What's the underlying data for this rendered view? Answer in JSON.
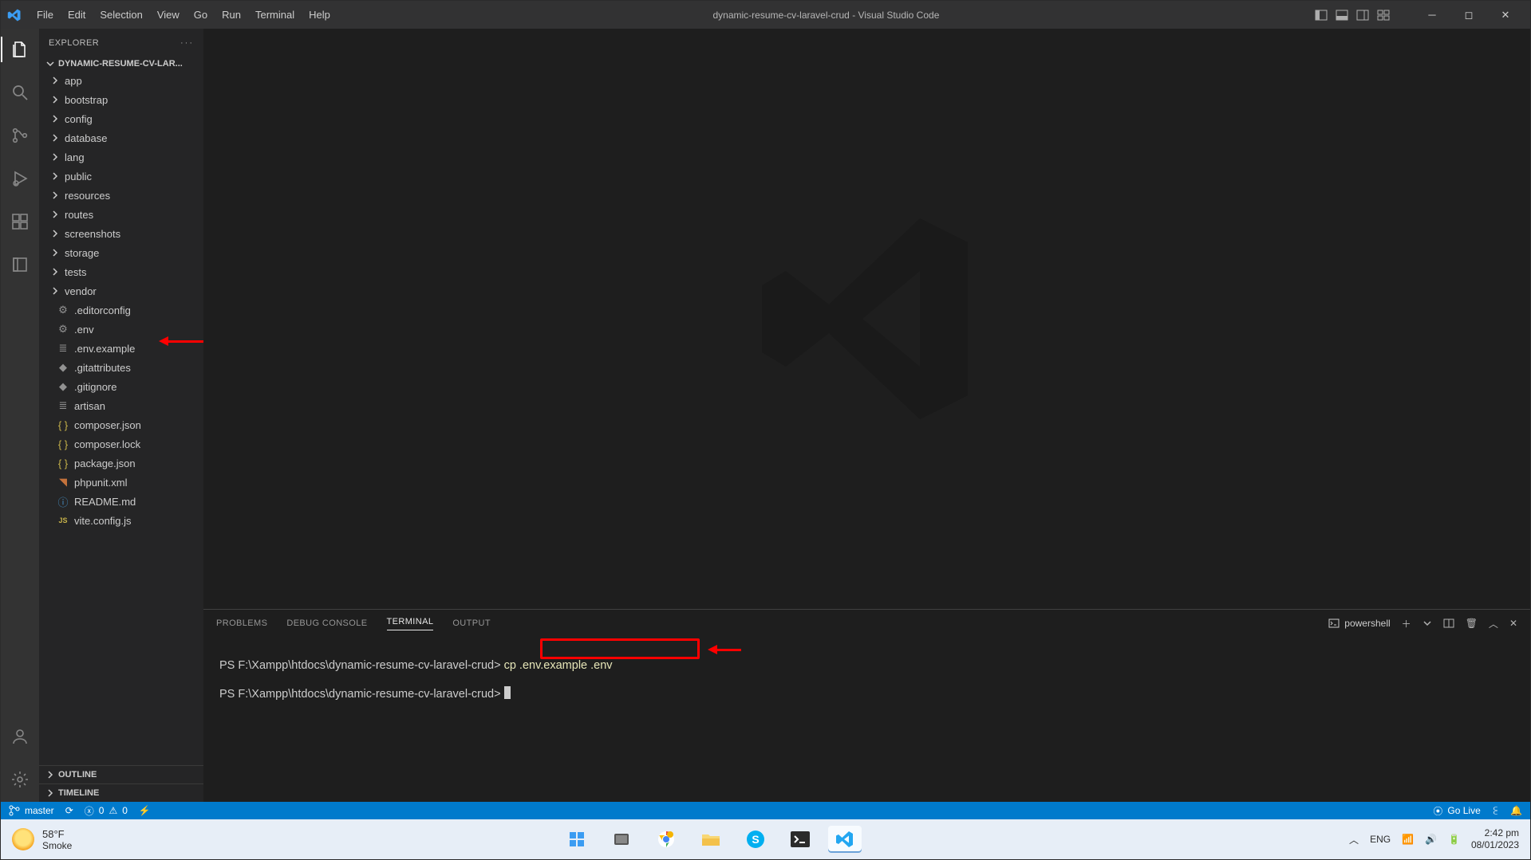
{
  "titlebar": {
    "menu": [
      "File",
      "Edit",
      "Selection",
      "View",
      "Go",
      "Run",
      "Terminal",
      "Help"
    ],
    "title": "dynamic-resume-cv-laravel-crud - Visual Studio Code"
  },
  "sidebar": {
    "header": "EXPLORER",
    "project": "DYNAMIC-RESUME-CV-LAR...",
    "folders": [
      "app",
      "bootstrap",
      "config",
      "database",
      "lang",
      "public",
      "resources",
      "routes",
      "screenshots",
      "storage",
      "tests",
      "vendor"
    ],
    "files": [
      {
        "name": ".editorconfig",
        "icon": "gear"
      },
      {
        "name": ".env",
        "icon": "gear"
      },
      {
        "name": ".env.example",
        "icon": "list"
      },
      {
        "name": ".gitattributes",
        "icon": "diamond"
      },
      {
        "name": ".gitignore",
        "icon": "diamond"
      },
      {
        "name": "artisan",
        "icon": "list"
      },
      {
        "name": "composer.json",
        "icon": "braces"
      },
      {
        "name": "composer.lock",
        "icon": "braces"
      },
      {
        "name": "package.json",
        "icon": "braces"
      },
      {
        "name": "phpunit.xml",
        "icon": "rss"
      },
      {
        "name": "README.md",
        "icon": "info"
      },
      {
        "name": "vite.config.js",
        "icon": "js"
      }
    ],
    "sections": [
      "OUTLINE",
      "TIMELINE"
    ]
  },
  "panel": {
    "tabs": [
      "PROBLEMS",
      "DEBUG CONSOLE",
      "TERMINAL",
      "OUTPUT"
    ],
    "active_tab": "TERMINAL",
    "shell_label": "powershell",
    "lines": [
      {
        "prompt": "PS F:\\Xampp\\htdocs\\dynamic-resume-cv-laravel-crud>",
        "cmd": "cp .env.example .env"
      },
      {
        "prompt": "PS F:\\Xampp\\htdocs\\dynamic-resume-cv-laravel-crud>",
        "cmd": ""
      }
    ]
  },
  "statusbar": {
    "branch_icon": "⎇",
    "branch": "master",
    "errors": "0",
    "warnings": "0",
    "golive": "Go Live"
  },
  "taskbar": {
    "temp": "58°F",
    "cond": "Smoke",
    "lang": "ENG",
    "time": "2:42 pm",
    "date": "08/01/2023"
  }
}
